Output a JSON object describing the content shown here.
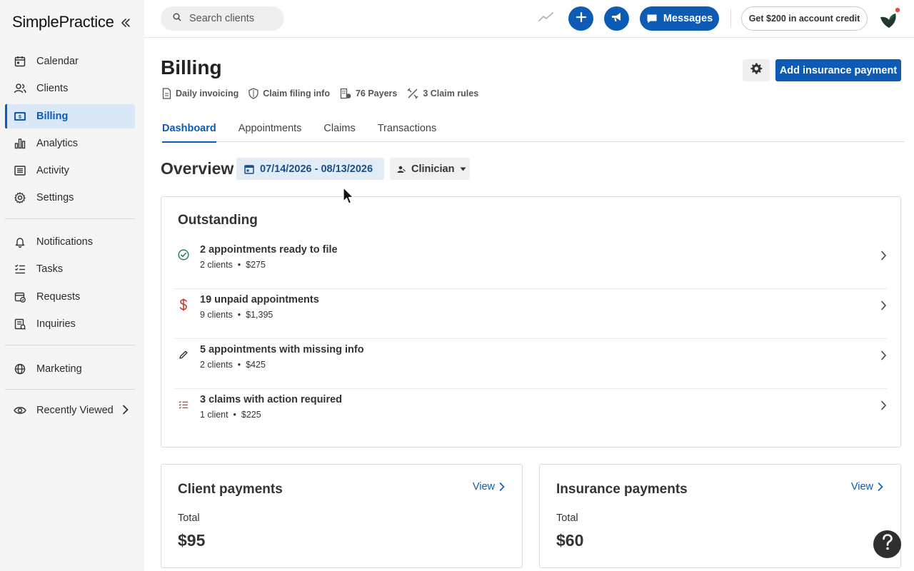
{
  "app": {
    "logo_text": "SimplePractice"
  },
  "sidebar": {
    "items": [
      {
        "label": "Calendar",
        "icon": "calendar-icon"
      },
      {
        "label": "Clients",
        "icon": "clients-icon"
      },
      {
        "label": "Billing",
        "icon": "billing-icon",
        "active": true
      },
      {
        "label": "Analytics",
        "icon": "analytics-icon"
      },
      {
        "label": "Activity",
        "icon": "activity-icon"
      },
      {
        "label": "Settings",
        "icon": "settings-icon"
      }
    ],
    "items2": [
      {
        "label": "Notifications",
        "icon": "bell-icon"
      },
      {
        "label": "Tasks",
        "icon": "tasks-icon"
      },
      {
        "label": "Requests",
        "icon": "requests-icon"
      },
      {
        "label": "Inquiries",
        "icon": "inquiries-icon"
      }
    ],
    "marketing": {
      "label": "Marketing",
      "icon": "globe-icon"
    },
    "recently_viewed": {
      "label": "Recently Viewed",
      "icon": "eye-icon"
    }
  },
  "topbar": {
    "search_placeholder": "Search clients",
    "messages_label": "Messages",
    "credit_label": "Get $200 in account credit"
  },
  "page": {
    "title": "Billing",
    "meta": [
      {
        "label": "Daily invoicing",
        "icon": "document-icon"
      },
      {
        "label": "Claim filing info",
        "icon": "shield-icon"
      },
      {
        "label": "76 Payers",
        "icon": "payers-icon"
      },
      {
        "label": "3 Claim rules",
        "icon": "rules-icon"
      }
    ],
    "primary_action": "Add insurance payment",
    "tabs": [
      "Dashboard",
      "Appointments",
      "Claims",
      "Transactions"
    ],
    "active_tab": "Dashboard"
  },
  "overview": {
    "title": "Overview",
    "date_range": "07/14/2026 - 08/13/2026",
    "clinician_label": "Clinician"
  },
  "outstanding": {
    "title": "Outstanding",
    "rows": [
      {
        "title": "2 appointments ready to file",
        "clients": "2 clients",
        "amount": "$275",
        "icon": "check-circle-icon",
        "icon_color": "#1f7a4d"
      },
      {
        "title": "19 unpaid appointments",
        "clients": "9 clients",
        "amount": "$1,395",
        "icon": "dollar-icon",
        "icon_color": "#c0392b"
      },
      {
        "title": "5 appointments with missing info",
        "clients": "2 clients",
        "amount": "$425",
        "icon": "pencil-icon",
        "icon_color": "#333333"
      },
      {
        "title": "3 claims with action required",
        "clients": "1 client",
        "amount": "$225",
        "icon": "checklist-icon",
        "icon_color": "#c0392b"
      }
    ]
  },
  "client_payments": {
    "title": "Client payments",
    "view_label": "View",
    "total_label": "Total",
    "total_value": "$95"
  },
  "insurance_payments": {
    "title": "Insurance payments",
    "view_label": "View",
    "total_label": "Total",
    "total_value": "$60"
  },
  "colors": {
    "brand": "#0d5bb5",
    "active_bg": "#dbe8f7",
    "date_bg": "#e2ecf6",
    "notification_dot": "#e74c3c"
  }
}
